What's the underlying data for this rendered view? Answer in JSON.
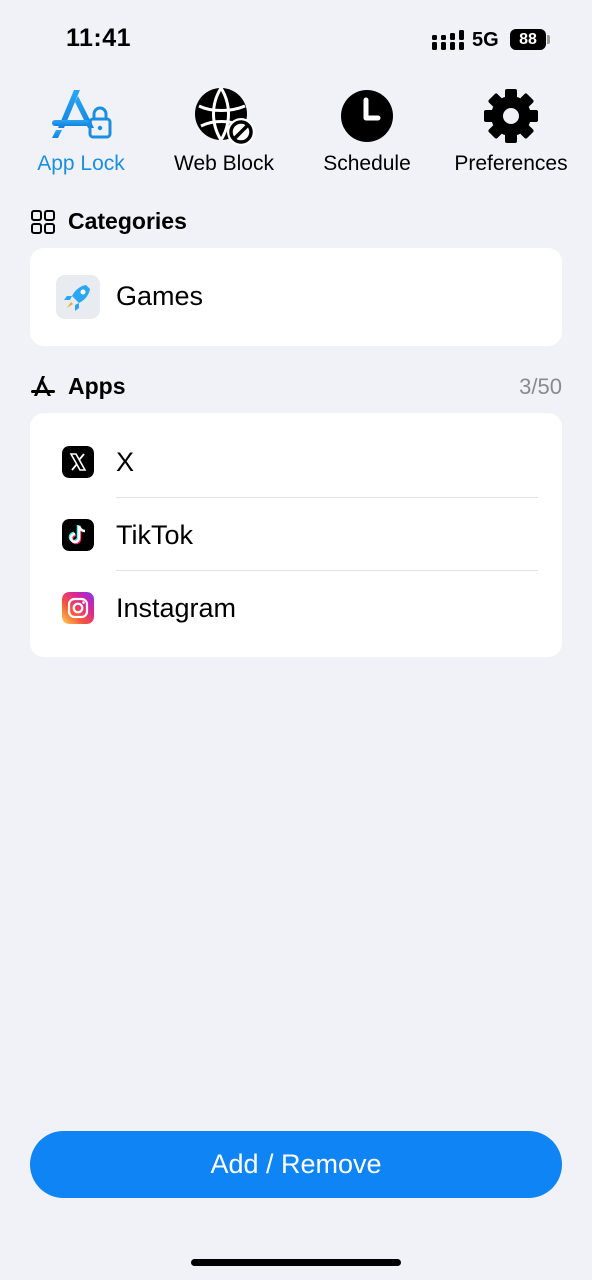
{
  "status_bar": {
    "time": "11:41",
    "network": "5G",
    "battery": "88"
  },
  "tabs": [
    {
      "label": "App Lock",
      "icon": "app-lock-icon",
      "active": true
    },
    {
      "label": "Web Block",
      "icon": "web-block-icon",
      "active": false
    },
    {
      "label": "Schedule",
      "icon": "clock-icon",
      "active": false
    },
    {
      "label": "Preferences",
      "icon": "gear-icon",
      "active": false
    }
  ],
  "categories": {
    "title": "Categories",
    "icon": "grid-icon",
    "items": [
      {
        "label": "Games",
        "icon": "rocket-icon"
      }
    ]
  },
  "apps": {
    "title": "Apps",
    "icon": "app-store-icon",
    "count": "3/50",
    "items": [
      {
        "label": "X",
        "icon": "x-logo-icon"
      },
      {
        "label": "TikTok",
        "icon": "tiktok-logo-icon"
      },
      {
        "label": "Instagram",
        "icon": "instagram-logo-icon"
      }
    ]
  },
  "actions": {
    "add_remove_label": "Add / Remove"
  },
  "colors": {
    "accent": "#0f84f5",
    "active_tab": "#1a8fe0",
    "background": "#f1f2f7",
    "secondary_text": "#8a8a8e"
  }
}
